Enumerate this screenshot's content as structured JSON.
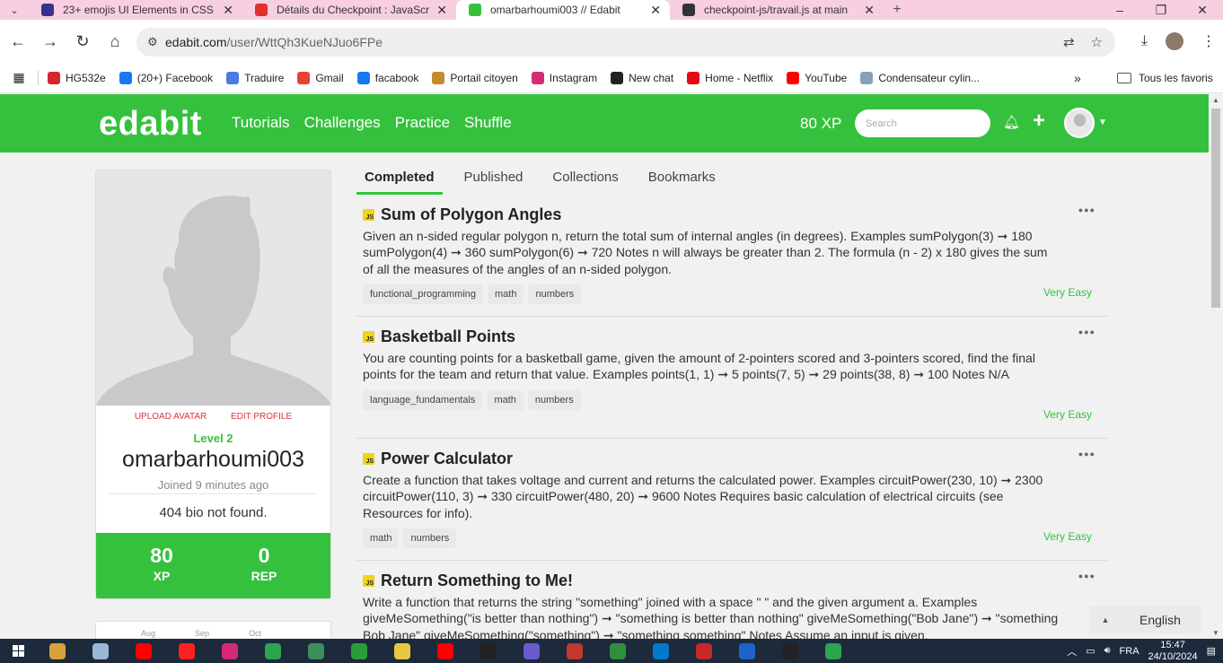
{
  "browser": {
    "tabs": [
      {
        "title": "23+ emojis UI Elements in CSS",
        "color": "#3b2f8f",
        "active": false
      },
      {
        "title": "Détails du Checkpoint : JavaScri",
        "color": "#e03030",
        "active": false
      },
      {
        "title": "omarbarhoumi003 // Edabit",
        "color": "#35c13e",
        "active": true
      },
      {
        "title": "checkpoint-js/travail.js at main",
        "color": "#333333",
        "active": false
      }
    ],
    "url_host": "edabit.com",
    "url_path": "/user/WttQh3KueNJuo6FPe",
    "bookmarks": [
      {
        "label": "HG532e",
        "color": "#d6252e"
      },
      {
        "label": "(20+) Facebook",
        "color": "#1877f2"
      },
      {
        "label": "Traduire",
        "color": "#4a7be0"
      },
      {
        "label": "Gmail",
        "color": "#ea4335"
      },
      {
        "label": "facabook",
        "color": "#1877f2"
      },
      {
        "label": "Portail citoyen",
        "color": "#c58a2a"
      },
      {
        "label": "Instagram",
        "color": "#d62976"
      },
      {
        "label": "New chat",
        "color": "#222222"
      },
      {
        "label": "Home - Netflix",
        "color": "#e50914"
      },
      {
        "label": "YouTube",
        "color": "#ff0000"
      },
      {
        "label": "Condensateur cylin...",
        "color": "#8aa0b8"
      }
    ],
    "all_bookmarks": "Tous les favoris"
  },
  "edabit": {
    "logo": "edabit",
    "nav": [
      "Tutorials",
      "Challenges",
      "Practice",
      "Shuffle"
    ],
    "xp": "80 XP",
    "search_placeholder": "Search",
    "accent": "#35c13e"
  },
  "profile": {
    "upload_avatar": "UPLOAD AVATAR",
    "edit_profile": "EDIT PROFILE",
    "level": "Level 2",
    "username": "omarbarhoumi003",
    "joined": "Joined 9 minutes ago",
    "bio": "404 bio not found.",
    "xp_value": "80",
    "xp_label": "XP",
    "rep_value": "0",
    "rep_label": "REP",
    "months": [
      "Aug",
      "Sep",
      "Oct"
    ]
  },
  "content_tabs": [
    "Completed",
    "Published",
    "Collections",
    "Bookmarks"
  ],
  "challenges": [
    {
      "title": "Sum of Polygon Angles",
      "description": "Given an n-sided regular polygon n, return the total sum of internal angles (in degrees). Examples sumPolygon(3) ➞ 180 sumPolygon(4) ➞ 360 sumPolygon(6) ➞ 720 Notes n will always be greater than 2. The formula (n - 2) x 180 gives the sum of all the measures of the angles of an n-sided polygon.",
      "tags": [
        "functional_programming",
        "math",
        "numbers"
      ],
      "difficulty": "Very Easy"
    },
    {
      "title": "Basketball Points",
      "description": "You are counting points for a basketball game, given the amount of 2-pointers scored and 3-pointers scored, find the final points for the team and return that value. Examples points(1, 1) ➞ 5 points(7, 5) ➞ 29 points(38, 8) ➞ 100 Notes N/A",
      "tags": [
        "language_fundamentals",
        "math",
        "numbers"
      ],
      "difficulty": "Very Easy"
    },
    {
      "title": "Power Calculator",
      "description": "Create a function that takes voltage and current and returns the calculated power. Examples circuitPower(230, 10) ➞ 2300 circuitPower(110, 3) ➞ 330 circuitPower(480, 20) ➞ 9600 Notes Requires basic calculation of electrical circuits (see Resources for info).",
      "tags": [
        "math",
        "numbers"
      ],
      "difficulty": "Very Easy"
    },
    {
      "title": "Return Something to Me!",
      "description": "Write a function that returns the string \"something\" joined with a space \" \" and the given argument a. Examples giveMeSomething(\"is better than nothing\") ➞ \"something is better than nothing\" giveMeSomething(\"Bob Jane\") ➞ \"something Bob Jane\" giveMeSomething(\"something\") ➞ \"something something\" Notes Assume an input is given.",
      "tags": [],
      "difficulty": ""
    }
  ],
  "language": "English",
  "taskbar": {
    "lang": "FRA",
    "time": "15:47",
    "date": "24/10/2024",
    "icons": [
      "#d8a23a",
      "#9ab7d8",
      "#ff0000",
      "#ff2020",
      "#d62976",
      "#2da44e",
      "#3a8f5a",
      "#2a9d3a",
      "#e8c840",
      "#ff0000",
      "#222222",
      "#6a5acd",
      "#c0392b",
      "#2f8f3a",
      "#007acc",
      "#c62828",
      "#1e64c8",
      "#222222",
      "#2da44e"
    ]
  }
}
